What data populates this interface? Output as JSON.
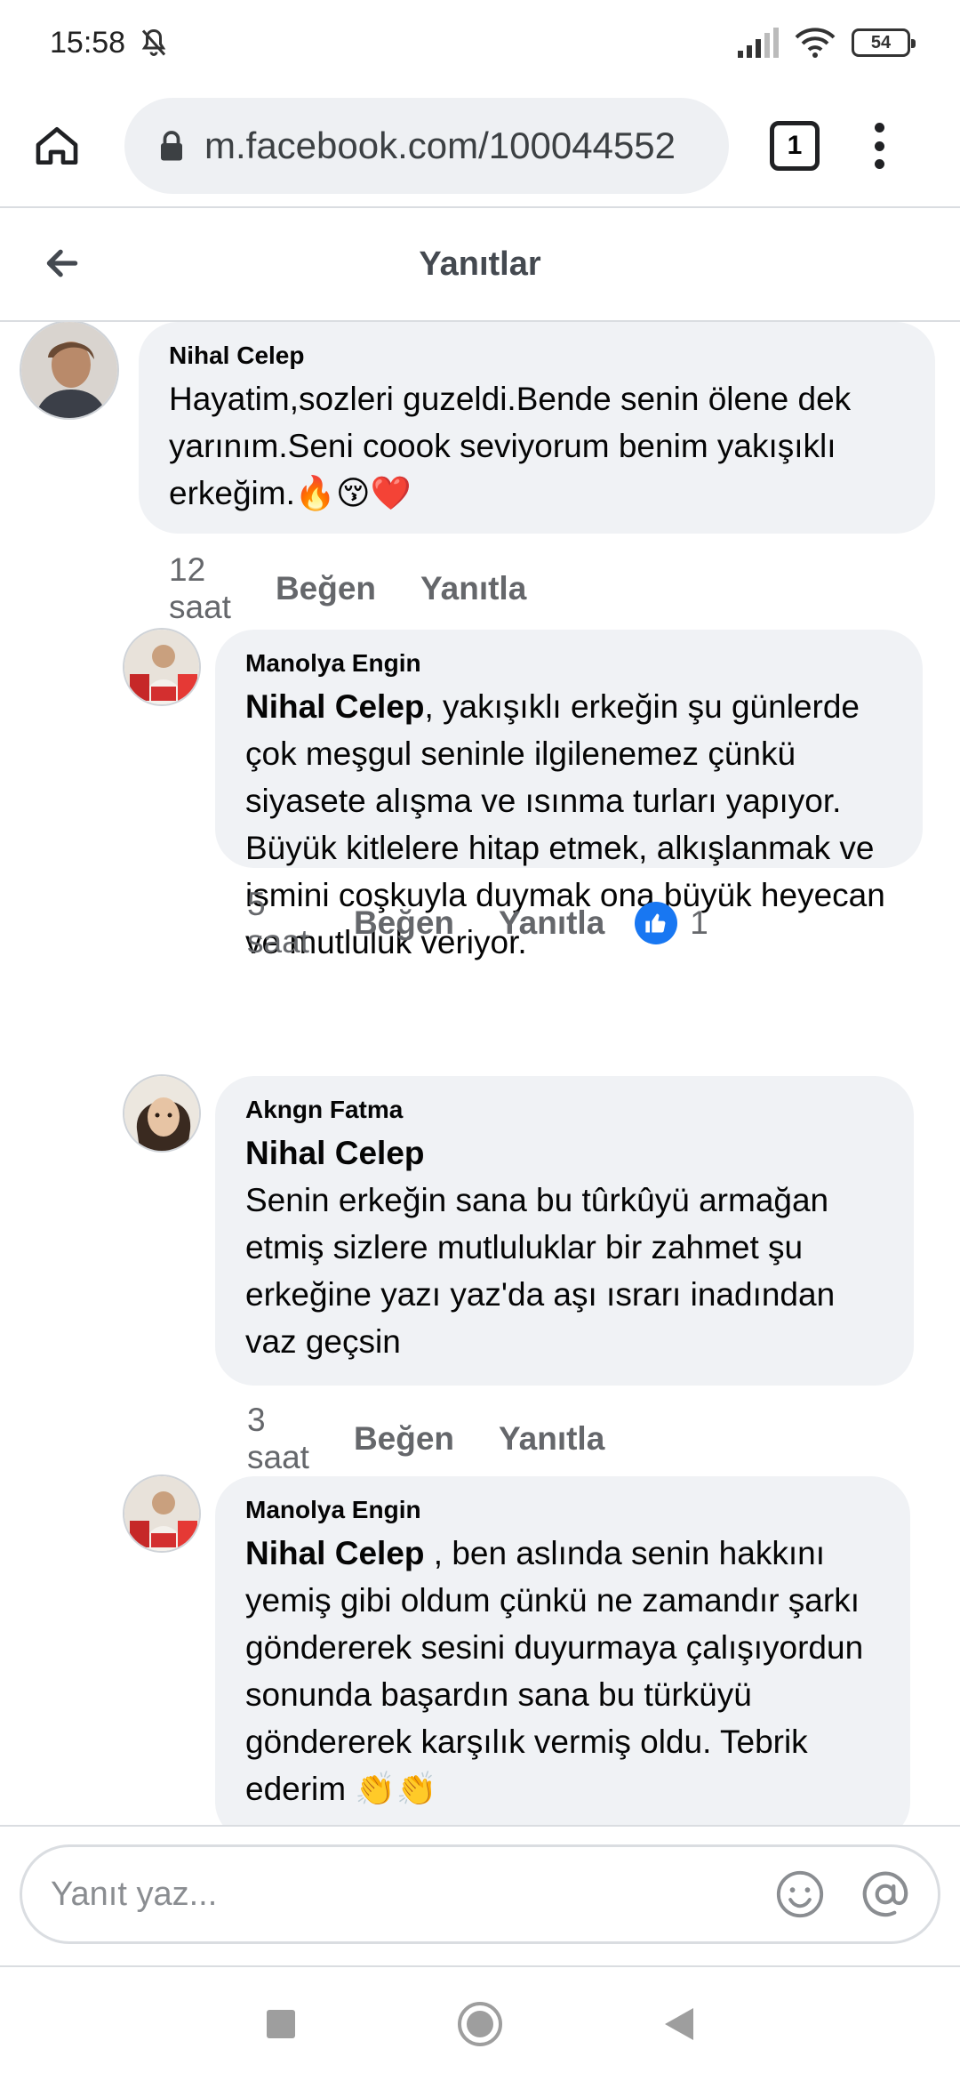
{
  "status_bar": {
    "time": "15:58",
    "battery": "54"
  },
  "browser": {
    "url": "m.facebook.com/100044552",
    "tab_count": "1"
  },
  "page": {
    "title": "Yanıtlar"
  },
  "comments": [
    {
      "author": "Nihal Celep",
      "text": "Hayatim,sozleri guzeldi.Bende senin ölene dek yarınım.Seni coook seviyorum benim yakışıklı erkeğim.🔥😚❤️",
      "time": "12 saat",
      "like": "Beğen",
      "reply": "Yanıtla"
    },
    {
      "author": "Manolya Engin",
      "mention": "Nihal Celep",
      "text": ", yakışıklı erkeğin şu günlerde çok meşgul seninle ilgilenemez çünkü siyasete alışma ve ısınma turları yapıyor. Büyük kitlelere hitap etmek, alkışlanmak ve ismini coşkuyla duymak ona büyük heyecan ve mutluluk veriyor.",
      "time": "5 saat",
      "like": "Beğen",
      "reply": "Yanıtla",
      "reaction_count": "1"
    },
    {
      "author": "Akngn Fatma",
      "mention": "Nihal Celep",
      "text": "Senin  erkeğin sana bu tûrkûyü armağan etmiş sizlere mutluluklar bir zahmet şu erkeğine yazı yaz'da aşı ısrarı inadından vaz geçsin",
      "time": "3 saat",
      "like": "Beğen",
      "reply": "Yanıtla"
    },
    {
      "author": "Manolya Engin",
      "mention": "Nihal Celep",
      "text": " , ben aslında senin hakkını yemiş gibi oldum çünkü ne zamandır şarkı göndererek sesini duyurmaya çalışıyordun sonunda başardın sana bu türküyü göndererek karşılık vermiş oldu. Tebrik ederim 👏👏"
    }
  ],
  "reply_input": {
    "placeholder": "Yanıt yaz..."
  },
  "colors": {
    "accent": "#1877f2",
    "bubble": "#f0f2f5",
    "meta": "#65676b"
  }
}
